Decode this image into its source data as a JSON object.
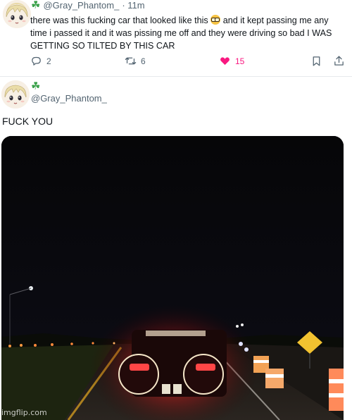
{
  "tweet": {
    "handle": "@Gray_Phantom_",
    "time": "· 11m",
    "text_before_emoji": "there was this fucking car that looked like this ",
    "text_after_emoji": " and it kept passing me any time i passed it and it was pissing me off and they were driving so bad I WAS GETTING SO TILTED BY THIS CAR",
    "emoji_icon": "nerd-face-emoji",
    "badge_icon": "four-leaf-clover-icon",
    "actions": {
      "reply_count": "2",
      "retweet_count": "6",
      "like_count": "15",
      "like_color": "#f91880"
    }
  },
  "reply": {
    "handle": "@Gray_Phantom_",
    "badge_icon": "four-leaf-clover-icon",
    "text": "FUCK YOU"
  },
  "media": {
    "description_icon": "night-highway-car-photo"
  },
  "watermark": "imgflip.com"
}
